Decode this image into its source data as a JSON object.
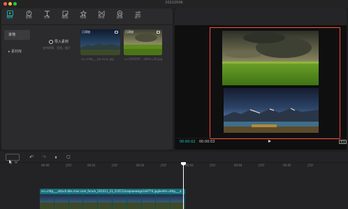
{
  "window": {
    "title": "20210506"
  },
  "colors": {
    "accent": "#1fc6c6",
    "highlight_border": "#ff4d34",
    "clip": "#16717a"
  },
  "toolbar": {
    "items": [
      {
        "label": "媒体",
        "icon": "media-icon",
        "active": true
      },
      {
        "label": "音频",
        "icon": "audio-icon",
        "active": false
      },
      {
        "label": "文本",
        "icon": "text-icon",
        "active": false
      },
      {
        "label": "贴纸",
        "icon": "sticker-icon",
        "active": false
      },
      {
        "label": "特效",
        "icon": "effects-icon",
        "active": false
      },
      {
        "label": "转场",
        "icon": "transition-icon",
        "active": false
      },
      {
        "label": "滤镜",
        "icon": "filter-icon",
        "active": false
      },
      {
        "label": "调节",
        "icon": "adjust-icon",
        "active": false
      }
    ]
  },
  "sidebar": {
    "items": [
      {
        "label": "本地"
      },
      {
        "label": "▸ 素材库"
      }
    ]
  },
  "import": {
    "label": "导入素材",
    "hint": "支持视频、音频、图片"
  },
  "media": [
    {
      "tag": "已添加",
      "caption": "src=http___ba.mzui.jpg"
    },
    {
      "tag": "已添加",
      "caption": "u=3565067...e&fm=26.jpg"
    }
  ],
  "player": {
    "current_time": "00:00:02",
    "total_time": "00:00:03",
    "ratio_label": "原始"
  },
  "timeline": {
    "ruler": [
      "00:00",
      "|15f",
      "00:01",
      "|15f",
      "00:02",
      "|15f",
      "00:03",
      "|15f",
      "00:04",
      "|15f",
      "00:05",
      "|15f"
    ],
    "clip_text": "src=http___attach.bbs.miui.com_forum_201011_23_210512xaqaaewagx2v8774.jpg&refer=http___a"
  }
}
